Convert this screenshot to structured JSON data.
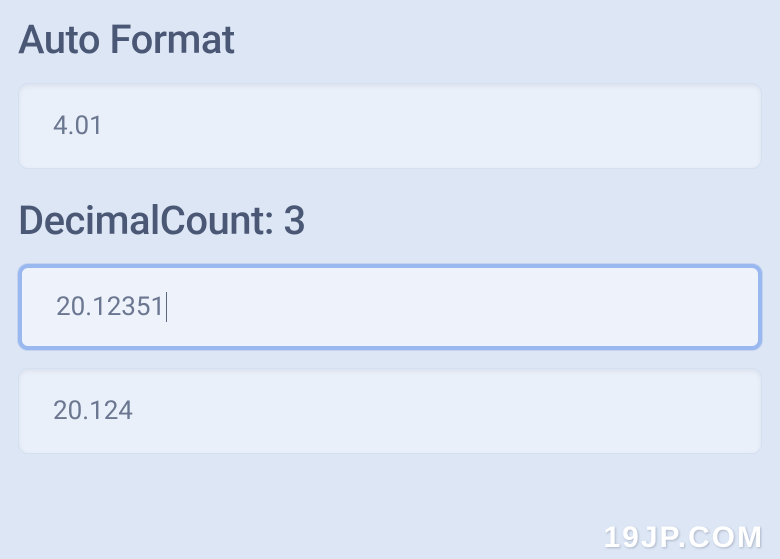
{
  "section1": {
    "heading": "Auto Format",
    "field": "4.01"
  },
  "section2": {
    "heading": "DecimalCount: 3",
    "input": "20.12351",
    "output": "20.124"
  },
  "watermark": "19JP.COM"
}
